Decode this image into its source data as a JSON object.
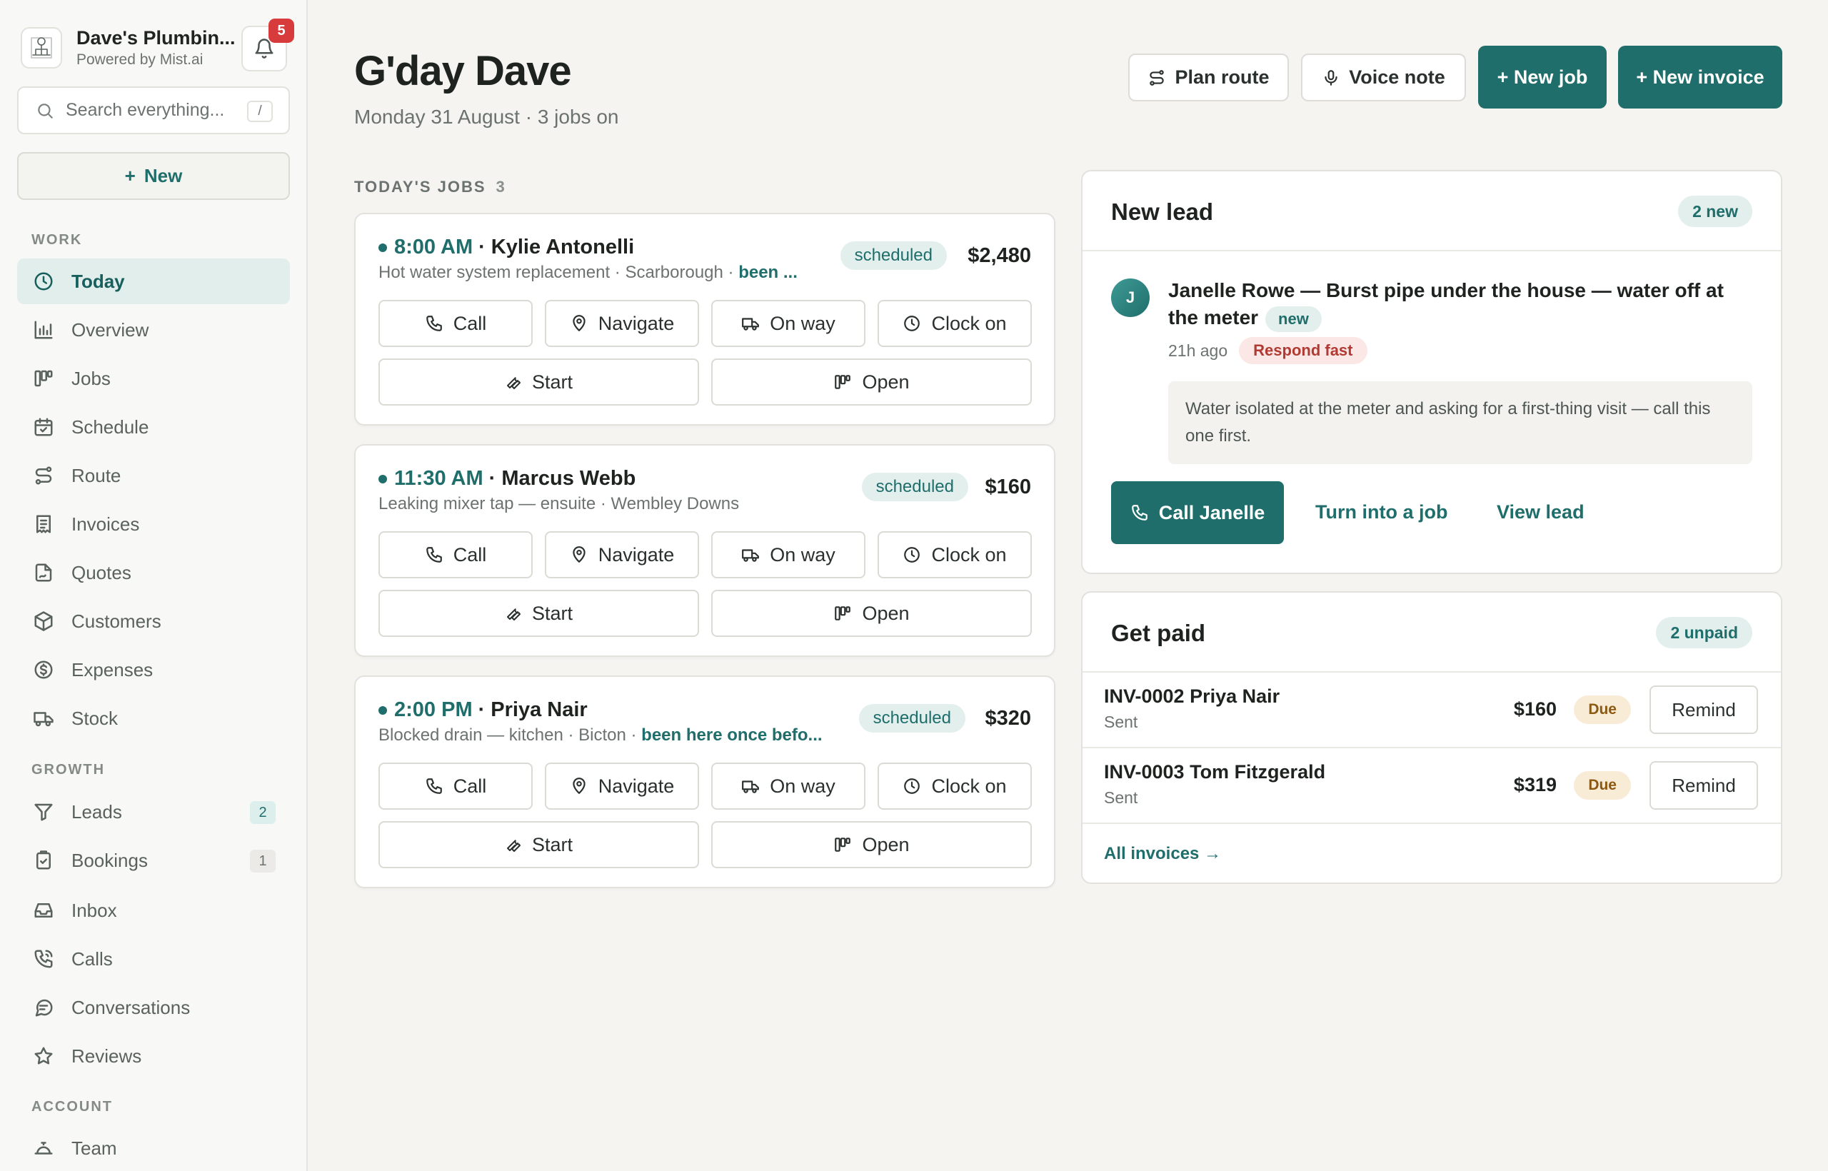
{
  "brand": {
    "name": "Dave's Plumbin...",
    "sub": "Powered by Mist.ai",
    "notifications": "5"
  },
  "search": {
    "placeholder": "Search everything...",
    "shortcut": "/"
  },
  "sidebar": {
    "new_label": "New",
    "sections": {
      "work": "WORK",
      "growth": "GROWTH",
      "account": "ACCOUNT"
    },
    "items": [
      {
        "label": "Today",
        "icon": "clock-icon"
      },
      {
        "label": "Overview",
        "icon": "bar-chart-icon"
      },
      {
        "label": "Jobs",
        "icon": "kanban-icon"
      },
      {
        "label": "Schedule",
        "icon": "calendar-icon"
      },
      {
        "label": "Route",
        "icon": "route-icon"
      },
      {
        "label": "Invoices",
        "icon": "receipt-icon"
      },
      {
        "label": "Quotes",
        "icon": "document-icon"
      },
      {
        "label": "Customers",
        "icon": "box-icon"
      },
      {
        "label": "Expenses",
        "icon": "dollar-icon"
      },
      {
        "label": "Stock",
        "icon": "truck-icon"
      },
      {
        "label": "Leads",
        "icon": "funnel-icon",
        "count": "2"
      },
      {
        "label": "Bookings",
        "icon": "clipboard-icon",
        "count": "1"
      },
      {
        "label": "Inbox",
        "icon": "inbox-icon"
      },
      {
        "label": "Calls",
        "icon": "phone-icon"
      },
      {
        "label": "Conversations",
        "icon": "chat-icon"
      },
      {
        "label": "Reviews",
        "icon": "star-icon"
      },
      {
        "label": "Team",
        "icon": "team-icon"
      }
    ]
  },
  "header": {
    "greeting": "G'day Dave",
    "subtitle": "Monday 31 August · 3 jobs on",
    "plan_route": "Plan route",
    "voice_note": "Voice note",
    "new_job": "+ New job",
    "new_invoice": "+ New invoice"
  },
  "jobs": {
    "heading": "TODAY'S JOBS",
    "count": "3",
    "actions": {
      "call": "Call",
      "navigate": "Navigate",
      "on_way": "On way",
      "clock_on": "Clock on",
      "start": "Start",
      "open": "Open"
    },
    "items": [
      {
        "time": "8:00 AM",
        "sep": "·",
        "name": "Kylie Antonelli",
        "desc": "Hot water system replacement · Scarborough · ",
        "hint": "been ...",
        "status": "scheduled",
        "amount": "$2,480"
      },
      {
        "time": "11:30 AM",
        "sep": "·",
        "name": "Marcus Webb",
        "desc": "Leaking mixer tap — ensuite · Wembley Downs",
        "hint": "",
        "status": "scheduled",
        "amount": "$160"
      },
      {
        "time": "2:00 PM",
        "sep": "·",
        "name": "Priya Nair",
        "desc": "Blocked drain — kitchen · Bicton · ",
        "hint": "been here once befo...",
        "status": "scheduled",
        "amount": "$320"
      }
    ]
  },
  "lead": {
    "title": "New lead",
    "chip": "2 new",
    "avatar": "J",
    "headline": "Janelle Rowe — Burst pipe under the house — water off at the meter",
    "tag": "new",
    "age": "21h ago",
    "urgency": "Respond fast",
    "note": "Water isolated at the meter and asking for a first-thing visit — call this one first.",
    "call": "Call Janelle",
    "turn_into_job": "Turn into a job",
    "view": "View lead"
  },
  "get_paid": {
    "title": "Get paid",
    "chip": "2 unpaid",
    "remind": "Remind",
    "invoices": [
      {
        "title": "INV-0002 Priya Nair",
        "status": "Sent",
        "amount": "$160",
        "due": "Due"
      },
      {
        "title": "INV-0003 Tom Fitzgerald",
        "status": "Sent",
        "amount": "$319",
        "due": "Due"
      }
    ],
    "all_link": "All invoices →"
  },
  "colors": {
    "accent": "#1f6e6b",
    "accent_soft": "#e2efed",
    "danger": "#d83b3b",
    "due_bg": "#f9ecd7"
  }
}
